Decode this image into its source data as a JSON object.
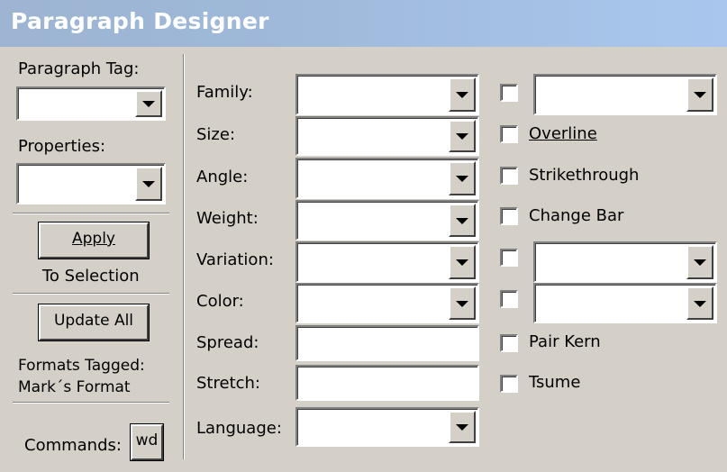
{
  "window": {
    "title": "Paragraph Designer"
  },
  "left_panel": {
    "paragraph_tag_label": "Paragraph Tag:",
    "paragraph_tag_value": "",
    "properties_label": "Properties:",
    "properties_value": "",
    "apply_button": "Apply",
    "apply_sub": "To Selection",
    "update_all_button": "Update All",
    "formats_tagged_label": "Formats Tagged:",
    "formats_tagged_value": "Mark´s Format",
    "commands_label": "Commands:",
    "commands_button": "wd"
  },
  "fields": {
    "family": {
      "label": "Family:",
      "value": ""
    },
    "size": {
      "label": "Size:",
      "value": ""
    },
    "angle": {
      "label": "Angle:",
      "value": ""
    },
    "weight": {
      "label": "Weight:",
      "value": ""
    },
    "variation": {
      "label": "Variation:",
      "value": ""
    },
    "color": {
      "label": "Color:",
      "value": ""
    },
    "spread": {
      "label": "Spread:",
      "value": ""
    },
    "stretch": {
      "label": "Stretch:",
      "value": ""
    },
    "language": {
      "label": "Language:",
      "value": ""
    }
  },
  "options": {
    "overline": "Overline",
    "strikethrough": "Strikethrough",
    "change_bar": "Change Bar",
    "pair_kern": "Pair Kern",
    "tsume": "Tsume",
    "underline_style_value": "",
    "superscript_value": "",
    "capitalization_value": ""
  },
  "checkboxes": {
    "underline": false,
    "overline": false,
    "strikethrough": false,
    "change_bar": false,
    "position": false,
    "case": false,
    "pair_kern": false,
    "tsume": false
  },
  "icons": {
    "dropdown": "chevron-down-icon"
  }
}
